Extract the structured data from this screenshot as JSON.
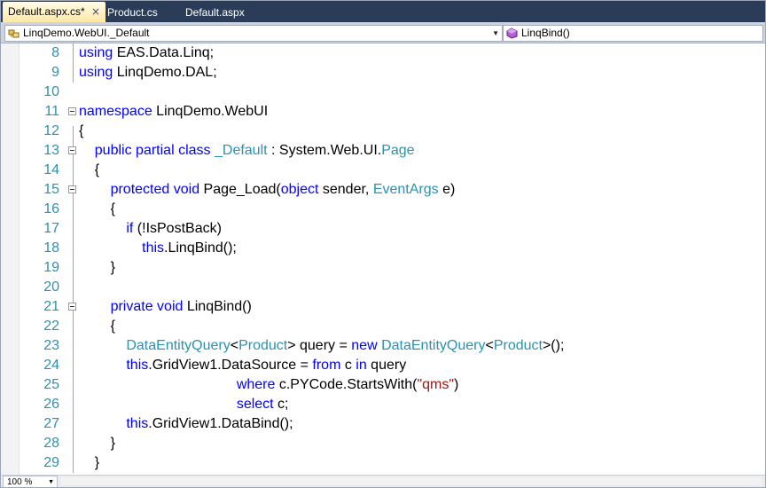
{
  "tabs": [
    {
      "label": "Default.aspx.cs*",
      "active": true
    },
    {
      "label": "Product.cs",
      "active": false
    },
    {
      "label": "Default.aspx",
      "active": false
    }
  ],
  "tab_close_glyph": "×",
  "nav": {
    "types_combo": "LinqDemo.WebUI._Default",
    "members_combo": "LinqBind()"
  },
  "zoom": "100 %",
  "code_lines": [
    {
      "n": "8",
      "html": "<span class=\"kw\">using</span> EAS.Data.Linq;"
    },
    {
      "n": "9",
      "html": "<span class=\"kw\">using</span> LinqDemo.DAL;"
    },
    {
      "n": "10",
      "html": ""
    },
    {
      "n": "11",
      "html": "<span class=\"kw\">namespace</span> LinqDemo.WebUI"
    },
    {
      "n": "12",
      "html": "{"
    },
    {
      "n": "13",
      "html": "    <span class=\"kw\">public</span> <span class=\"kw\">partial</span> <span class=\"kw\">class</span> <span class=\"ty\">_Default</span> : System.Web.UI.<span class=\"ty\">Page</span>"
    },
    {
      "n": "14",
      "html": "    {"
    },
    {
      "n": "15",
      "html": "        <span class=\"kw\">protected</span> <span class=\"kw\">void</span> Page_Load(<span class=\"kw\">object</span> sender, <span class=\"ty\">EventArgs</span> e)"
    },
    {
      "n": "16",
      "html": "        {"
    },
    {
      "n": "17",
      "html": "            <span class=\"kw\">if</span> (!IsPostBack)"
    },
    {
      "n": "18",
      "html": "                <span class=\"kw\">this</span>.LinqBind();"
    },
    {
      "n": "19",
      "html": "        }"
    },
    {
      "n": "20",
      "html": ""
    },
    {
      "n": "21",
      "html": "        <span class=\"kw\">private</span> <span class=\"kw\">void</span> LinqBind()"
    },
    {
      "n": "22",
      "html": "        {"
    },
    {
      "n": "23",
      "html": "            <span class=\"ty\">DataEntityQuery</span>&lt;<span class=\"ty\">Product</span>&gt; query = <span class=\"kw\">new</span> <span class=\"ty\">DataEntityQuery</span>&lt;<span class=\"ty\">Product</span>&gt;();"
    },
    {
      "n": "24",
      "html": "            <span class=\"kw\">this</span>.GridView1.DataSource = <span class=\"kw\">from</span> c <span class=\"kw\">in</span> query"
    },
    {
      "n": "25",
      "html": "                                        <span class=\"kw\">where</span> c.PYCode.StartsWith(<span class=\"str\">\"qms\"</span>)"
    },
    {
      "n": "26",
      "html": "                                        <span class=\"kw\">select</span> c;"
    },
    {
      "n": "27",
      "html": "            <span class=\"kw\">this</span>.GridView1.DataBind();"
    },
    {
      "n": "28",
      "html": "        }"
    },
    {
      "n": "29",
      "html": "    }"
    }
  ],
  "fold_lines": [
    "11",
    "13",
    "15",
    "21"
  ],
  "colors": {
    "keyword": "#0000ff",
    "type": "#2b91af",
    "string": "#a31515",
    "line_number": "#2b91af",
    "tab_strip": "#2b3c59"
  }
}
